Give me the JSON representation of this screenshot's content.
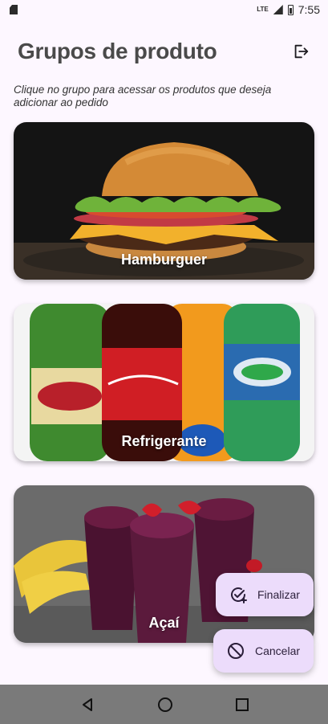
{
  "status": {
    "time": "7:55",
    "network": "LTE"
  },
  "header": {
    "title": "Grupos de produto"
  },
  "subtitle": "Clique no grupo para acessar os produtos que deseja adicionar ao pedido",
  "groups": [
    {
      "label": "Hamburguer"
    },
    {
      "label": "Refrigerante"
    },
    {
      "label": "Açaí"
    }
  ],
  "actions": {
    "finalize_label": "Finalizar",
    "cancel_label": "Cancelar"
  },
  "colors": {
    "background": "#fdf7ff",
    "fab": "#ecdcfb",
    "navbar": "#7a7a7a"
  }
}
